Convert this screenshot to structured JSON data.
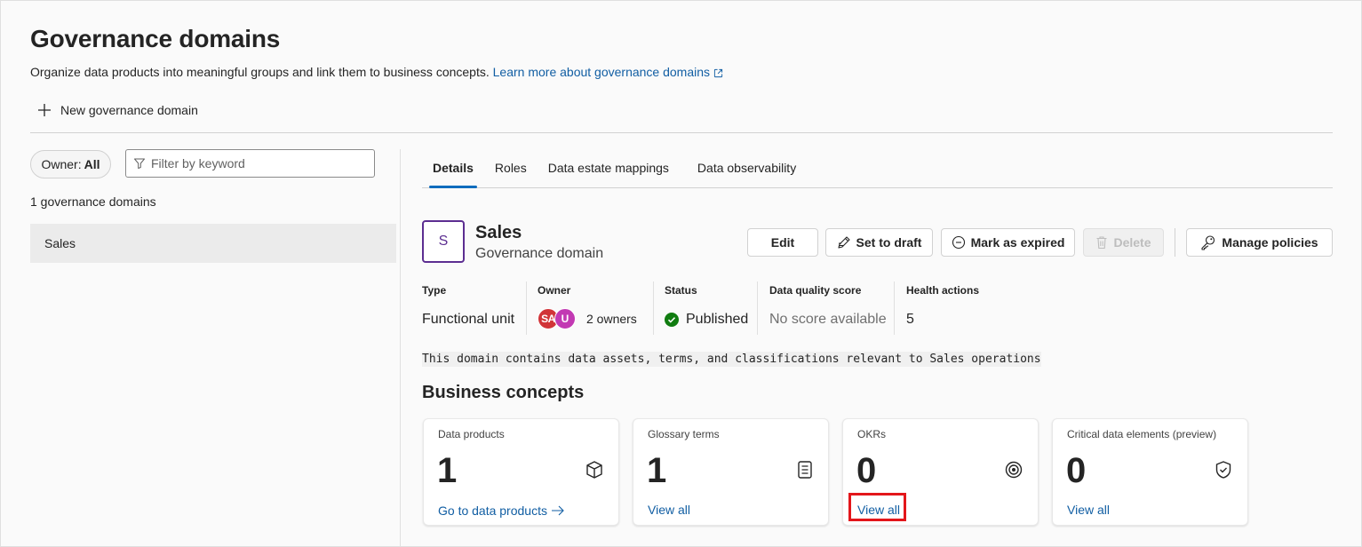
{
  "page": {
    "title": "Governance domains",
    "subtitle": "Organize data products into meaningful groups and link them to business concepts.",
    "learn_more": "Learn more about governance domains",
    "new_button": "New governance domain"
  },
  "left": {
    "owner_filter_prefix": "Owner:",
    "owner_filter_value": "All",
    "filter_placeholder": "Filter by keyword",
    "count_text": "1 governance domains",
    "domains": [
      "Sales"
    ]
  },
  "tabs": [
    "Details",
    "Roles",
    "Data estate mappings",
    "Data observability"
  ],
  "domain": {
    "initial": "S",
    "name": "Sales",
    "kind": "Governance domain",
    "actions": {
      "edit": "Edit",
      "draft": "Set to draft",
      "expire": "Mark as expired",
      "delete": "Delete",
      "policies": "Manage policies"
    },
    "meta": {
      "type_label": "Type",
      "type_value": "Functional unit",
      "owner_label": "Owner",
      "owner_avatars": [
        {
          "initials": "SA",
          "color": "#d13438"
        },
        {
          "initials": "U",
          "color": "#c239b3"
        }
      ],
      "owner_count": "2 owners",
      "status_label": "Status",
      "status_value": "Published",
      "status_color": "#107c10",
      "dq_label": "Data quality score",
      "dq_value": "No score available",
      "health_label": "Health actions",
      "health_value": "5"
    },
    "description": "This domain contains data assets, terms, and classifications relevant to Sales operations"
  },
  "business_concepts": {
    "title": "Business concepts",
    "cards": [
      {
        "label": "Data products",
        "value": "1",
        "link": "Go to data products",
        "icon": "cube-icon"
      },
      {
        "label": "Glossary terms",
        "value": "1",
        "link": "View all",
        "icon": "document-icon"
      },
      {
        "label": "OKRs",
        "value": "0",
        "link": "View all",
        "icon": "target-icon"
      },
      {
        "label": "Critical data elements (preview)",
        "value": "0",
        "link": "View all",
        "icon": "shield-check-icon"
      }
    ]
  },
  "colors": {
    "accent": "#0f6cbd",
    "link": "#115ea3",
    "domain_avatar": "#5c2e91",
    "highlight": "#e3161b"
  }
}
